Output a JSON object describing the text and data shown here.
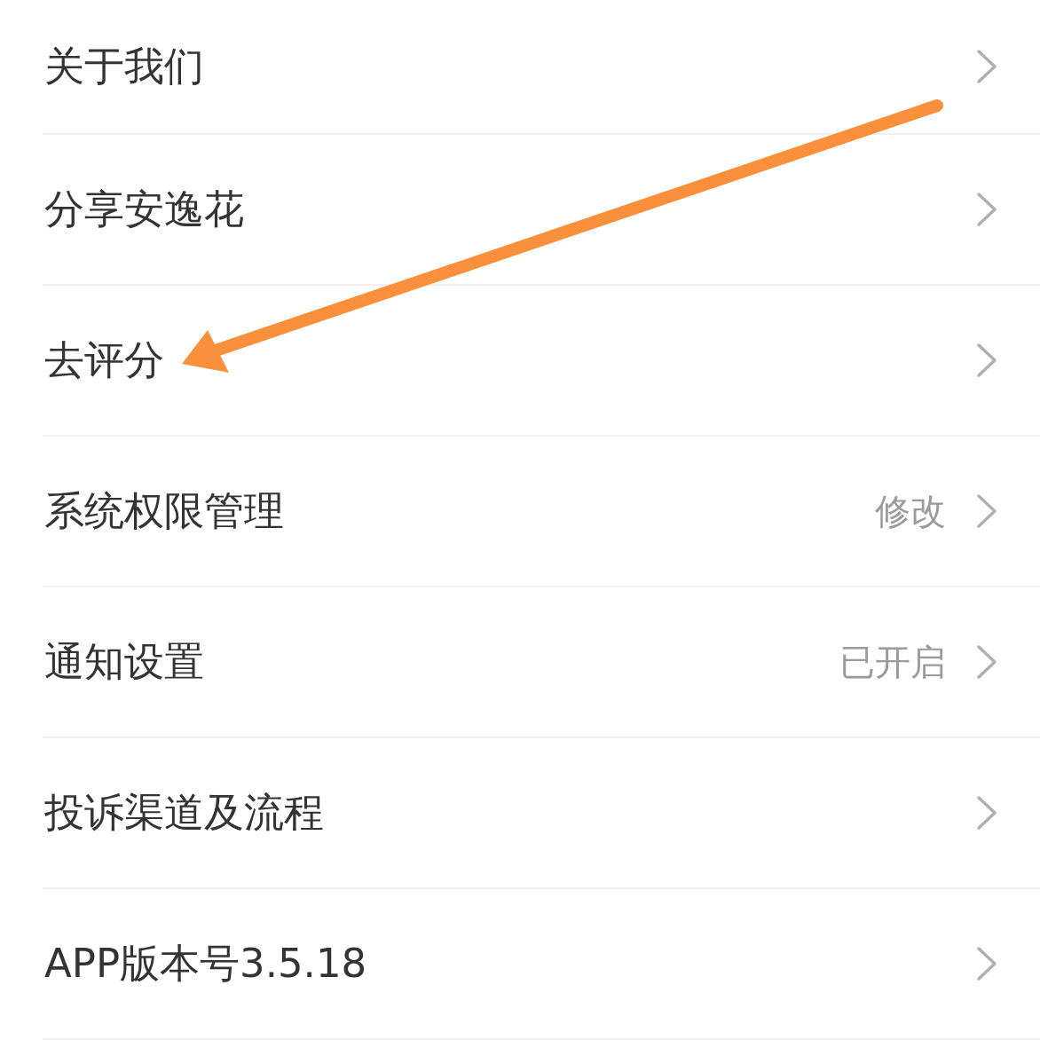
{
  "settings": {
    "items": [
      {
        "label": "关于我们"
      },
      {
        "label": "分享安逸花"
      },
      {
        "label": "去评分"
      },
      {
        "label": "系统权限管理",
        "value": "修改"
      },
      {
        "label": "通知设置",
        "value": "已开启"
      },
      {
        "label": "投诉渠道及流程"
      },
      {
        "label": "APP版本号3.5.18"
      }
    ]
  }
}
